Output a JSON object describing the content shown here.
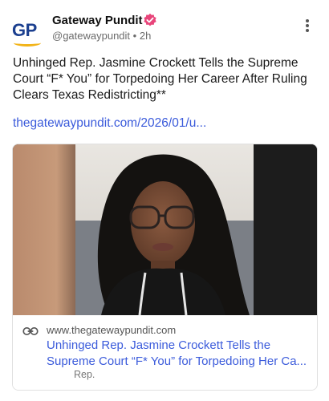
{
  "post": {
    "author": "Gateway Pundit",
    "avatar_text": "GP",
    "handle": "@gatewaypundit",
    "separator": "•",
    "time": "2h",
    "verified": true,
    "more_icon": "more-vertical-icon",
    "headline": "Unhinged Rep. Jasmine Crockett Tells the Supreme Court “F* You” for Torpedoing Her Career After Ruling Clears Texas Redistricting**",
    "link": "thegatewaypundit.com/2026/01/u..."
  },
  "card": {
    "domain": "www.thegatewaypundit.com",
    "title": "Unhinged Rep. Jasmine Crockett Tells the Supreme Court “F* You” for Torpedoing Her Ca...",
    "description": "Rep."
  },
  "colors": {
    "link": "#3b5bdb",
    "verified_badge": "#e8457a",
    "brand_blue": "#1b3f8f",
    "brand_gold": "#f2b317"
  }
}
